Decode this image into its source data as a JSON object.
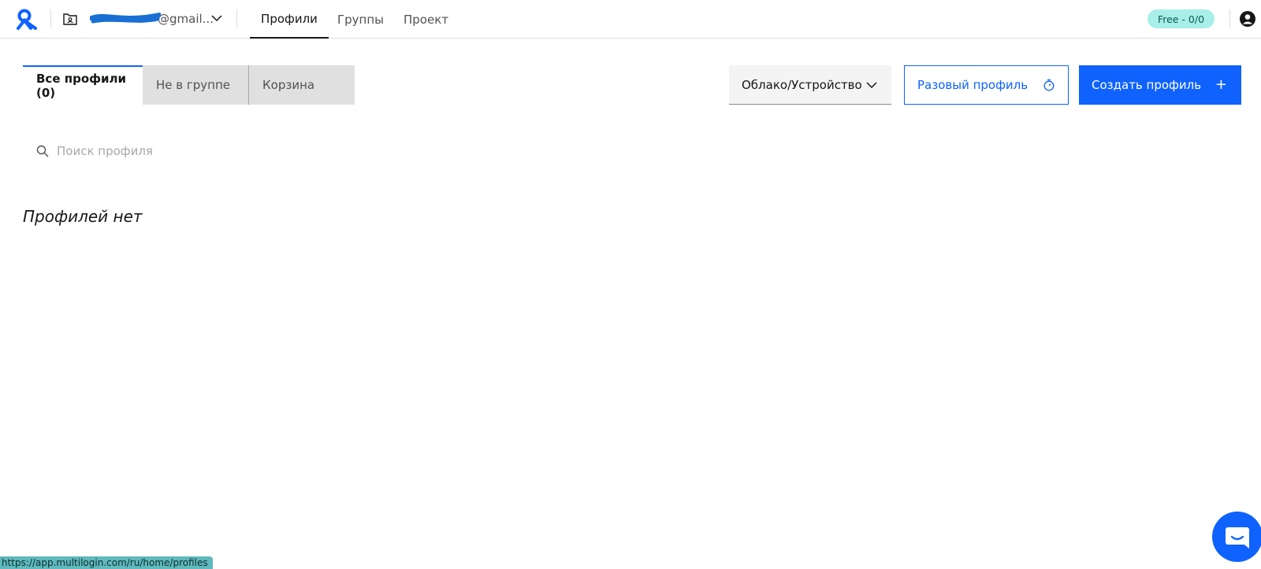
{
  "header": {
    "account_email": "@gmail...",
    "nav": [
      {
        "label": "Профили",
        "active": true
      },
      {
        "label": "Группы",
        "active": false
      },
      {
        "label": "Проект",
        "active": false
      }
    ],
    "plan_badge": "Free - 0/0"
  },
  "filters": {
    "tabs": [
      {
        "label": "Все профили (0)",
        "active": true
      },
      {
        "label": "Не в группе",
        "active": false
      },
      {
        "label": "Корзина",
        "active": false
      }
    ]
  },
  "toolbar": {
    "storage_select": "Облако/Устройство",
    "one_time_profile": "Разовый профиль",
    "create_profile": "Создать профиль",
    "create_plus": "+"
  },
  "search": {
    "placeholder": "Поиск профиля",
    "value": ""
  },
  "empty_state": "Профилей нет",
  "status_bar_url": "https://app.multilogin.com/ru/home/profiles",
  "colors": {
    "accent": "#0f62fe",
    "badge_bg": "#a7efe8",
    "tab_inactive_bg": "#e0e0e0"
  }
}
